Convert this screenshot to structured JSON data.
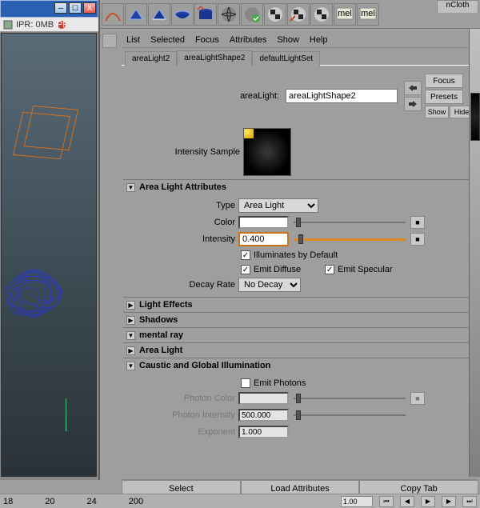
{
  "left": {
    "ipr": "IPR: 0MB"
  },
  "shelf": {
    "ncloth_tab": "nCloth"
  },
  "menus": [
    "List",
    "Selected",
    "Focus",
    "Attributes",
    "Show",
    "Help"
  ],
  "tabs": {
    "t1": "areaLight2",
    "t2": "areaLightShape2",
    "t3": "defaultLightSet"
  },
  "header": {
    "label": "areaLight:",
    "value": "areaLightShape2"
  },
  "side_buttons": {
    "focus": "Focus",
    "presets": "Presets",
    "show": "Show",
    "hide": "Hide"
  },
  "sample_label": "Intensity Sample",
  "sections": {
    "area_attrs": {
      "title": "Area Light Attributes",
      "type_lbl": "Type",
      "type_val": "Area Light",
      "color_lbl": "Color",
      "intensity_lbl": "Intensity",
      "intensity_val": "0.400",
      "illum": "Illuminates by Default",
      "diffuse": "Emit Diffuse",
      "specular": "Emit Specular",
      "decay_lbl": "Decay Rate",
      "decay_val": "No Decay"
    },
    "light_effects": "Light Effects",
    "shadows": "Shadows",
    "mental_ray": "mental ray",
    "area_light": "Area Light",
    "caustic": {
      "title": "Caustic and Global Illumination",
      "emit_photons": "Emit Photons",
      "photon_color": "Photon Color",
      "photon_intensity": "Photon Intensity",
      "photon_intensity_val": "500.000",
      "exponent": "Exponent",
      "exponent_val": "1.000"
    }
  },
  "bottom": {
    "select": "Select",
    "load": "Load Attributes",
    "copy": "Copy Tab"
  },
  "timeline": {
    "frames": [
      "18",
      "20",
      "24",
      "200"
    ],
    "cur": "1.00",
    "end": "200"
  }
}
